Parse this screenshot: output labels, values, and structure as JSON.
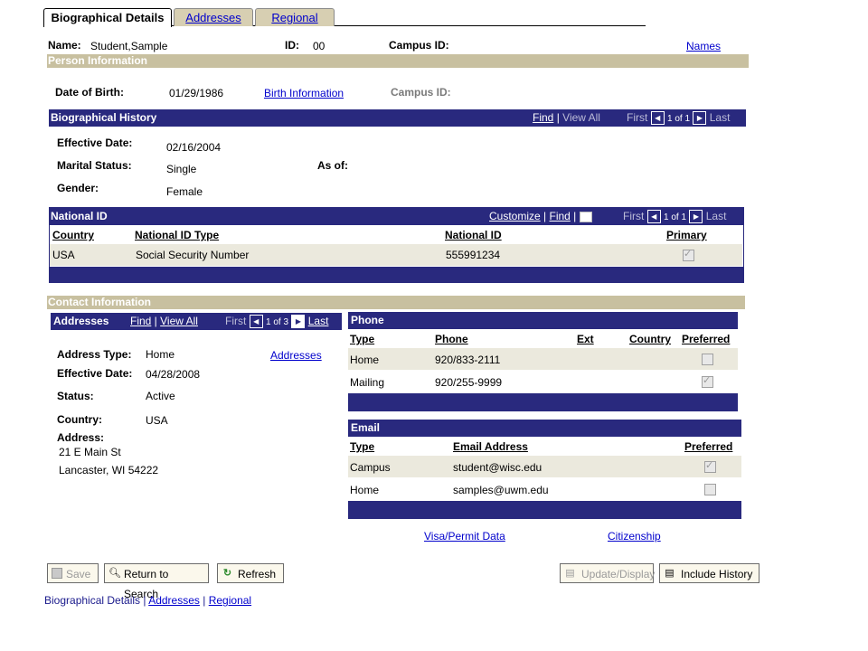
{
  "tabs": [
    {
      "label": "Biographical Details",
      "active": true
    },
    {
      "label": "Addresses",
      "active": false
    },
    {
      "label": "Regional",
      "active": false
    }
  ],
  "header": {
    "name_label": "Name:",
    "name_value": "Student,Sample",
    "id_label": "ID:",
    "id_value": "00",
    "campus_id_label": "Campus ID:",
    "names_link": "Names"
  },
  "person_info": {
    "title": "Person Information",
    "dob_label": "Date of Birth:",
    "dob_value": "01/29/1986",
    "birth_info_link": "Birth Information",
    "campus_id_label": "Campus ID:"
  },
  "bio_history": {
    "title": "Biographical History",
    "find": "Find",
    "sep": "|",
    "view_all": "View All",
    "first": "First",
    "range": "1 of 1",
    "last": "Last",
    "effective_date_label": "Effective Date:",
    "effective_date_value": "02/16/2004",
    "marital_label": "Marital Status:",
    "marital_value": "Single",
    "as_of_label": "As of:",
    "gender_label": "Gender:",
    "gender_value": "Female"
  },
  "national_id": {
    "title": "National ID",
    "customize": "Customize",
    "find": "Find",
    "first": "First",
    "range": "1 of 1",
    "last": "Last",
    "columns": [
      "Country",
      "National ID Type",
      "National ID",
      "Primary"
    ],
    "rows": [
      {
        "country": "USA",
        "type": "Social Security Number",
        "id": "555991234",
        "primary": true
      }
    ]
  },
  "contact": {
    "title": "Contact Information",
    "addresses": {
      "title": "Addresses",
      "find": "Find",
      "view_all": "View All",
      "first": "First",
      "range": "1 of 3",
      "last": "Last",
      "type_label": "Address Type:",
      "type_value": "Home",
      "addresses_link": "Addresses",
      "eff_label": "Effective Date:",
      "eff_value": "04/28/2008",
      "status_label": "Status:",
      "status_value": "Active",
      "country_label": "Country:",
      "country_value": "USA",
      "address_label": "Address:",
      "line1": "21 E Main St",
      "line2": "Lancaster, WI 54222"
    },
    "phone": {
      "title": "Phone",
      "columns": [
        "Type",
        "Phone",
        "Ext",
        "Country",
        "Preferred"
      ],
      "rows": [
        {
          "type": "Home",
          "phone": "920/833-2111",
          "preferred": false
        },
        {
          "type": "Mailing",
          "phone": "920/255-9999",
          "preferred": true
        }
      ]
    },
    "email": {
      "title": "Email",
      "columns": [
        "Type",
        "Email Address",
        "Preferred"
      ],
      "rows": [
        {
          "type": "Campus",
          "email": "student@wisc.edu",
          "preferred": true
        },
        {
          "type": "Home",
          "email": "samples@uwm.edu",
          "preferred": false
        }
      ]
    },
    "visa_link": "Visa/Permit Data",
    "citizenship_link": "Citizenship"
  },
  "buttons": {
    "save": "Save",
    "return": "Return to Search",
    "refresh": "Refresh",
    "update": "Update/Display",
    "include": "Include History"
  },
  "footer": {
    "current": "Biographical Details",
    "sep": "|",
    "addresses": "Addresses",
    "regional": "Regional"
  }
}
